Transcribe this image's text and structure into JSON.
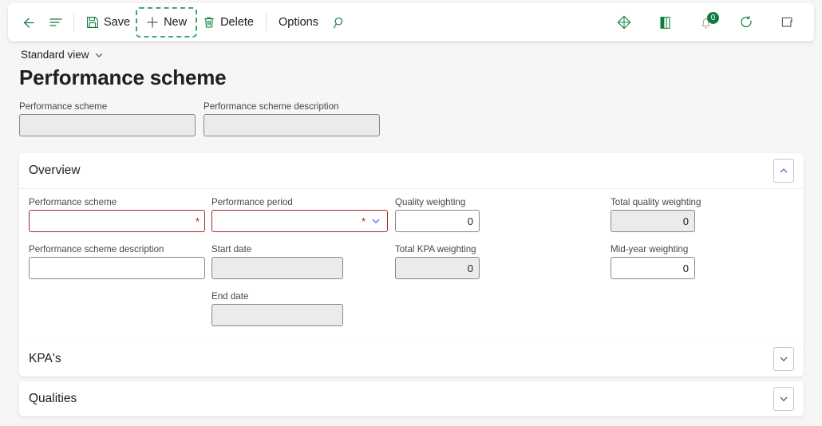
{
  "colors": {
    "accent_green": "#107c41",
    "required_red": "#a4262c",
    "focus_green": "#3aa76d",
    "page_bg": "#f7f6f5",
    "card_bg": "#ffffff",
    "readonly_bg": "#edebe9"
  },
  "toolbar": {
    "back_icon": "back-arrow-icon",
    "menu_icon": "show-list-icon",
    "save_label": "Save",
    "save_icon": "save-floppy-icon",
    "new_label": "New",
    "new_icon": "plus-icon",
    "delete_label": "Delete",
    "delete_icon": "trash-icon",
    "options_label": "Options",
    "search_icon": "search-icon",
    "right_icons": [
      {
        "name": "dynamics-diamond-icon"
      },
      {
        "name": "help-book-icon"
      },
      {
        "name": "notifications-bell-icon",
        "badge": "0"
      },
      {
        "name": "refresh-icon"
      },
      {
        "name": "open-in-new-window-icon"
      }
    ]
  },
  "header": {
    "view_selector": "Standard view",
    "view_chevron_icon": "chevron-down-icon",
    "title": "Performance scheme",
    "fields": [
      {
        "label": "Performance scheme",
        "value": "",
        "readonly": true
      },
      {
        "label": "Performance scheme description",
        "value": "",
        "readonly": true
      }
    ]
  },
  "sections": [
    {
      "title": "Overview",
      "expanded": true,
      "toggle_icon": "chevron-up-icon",
      "fields": [
        {
          "label": "Performance scheme",
          "value": "",
          "required": true,
          "readonly": false,
          "dropdown": false,
          "align": "left"
        },
        {
          "label": "Performance period",
          "value": "",
          "required": true,
          "readonly": false,
          "dropdown": true,
          "align": "left"
        },
        {
          "label": "Quality weighting",
          "value": "0",
          "required": false,
          "readonly": false,
          "dropdown": false,
          "align": "right"
        },
        {
          "label": "Total quality weighting",
          "value": "0",
          "required": false,
          "readonly": true,
          "dropdown": false,
          "align": "right"
        },
        {
          "label": "Performance scheme description",
          "value": "",
          "required": false,
          "readonly": false,
          "dropdown": false,
          "align": "left"
        },
        {
          "label": "Start date",
          "value": "",
          "required": false,
          "readonly": true,
          "dropdown": false,
          "align": "left"
        },
        {
          "label": "Total KPA weighting",
          "value": "0",
          "required": false,
          "readonly": true,
          "dropdown": false,
          "align": "right"
        },
        {
          "label": "Mid-year weighting",
          "value": "0",
          "required": false,
          "readonly": false,
          "dropdown": false,
          "align": "right"
        },
        {
          "label": "End date",
          "value": "",
          "required": false,
          "readonly": true,
          "dropdown": false,
          "align": "left"
        }
      ]
    },
    {
      "title": "KPA's",
      "expanded": false,
      "toggle_icon": "chevron-down-icon"
    },
    {
      "title": "Qualities",
      "expanded": false,
      "toggle_icon": "chevron-down-icon"
    }
  ],
  "required_marker": "*"
}
